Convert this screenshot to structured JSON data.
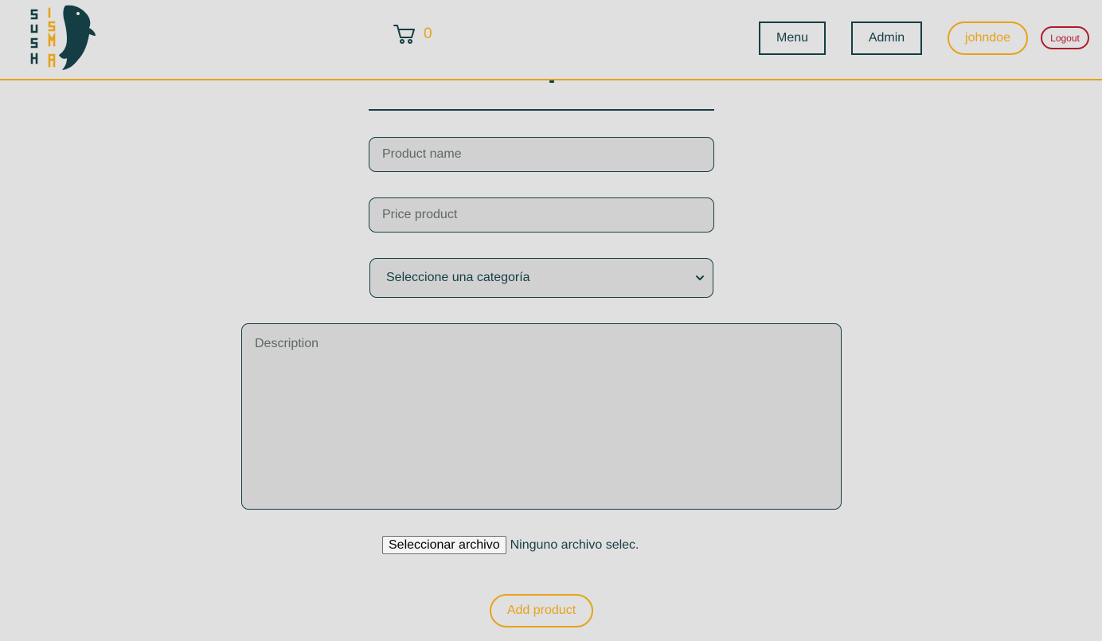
{
  "header": {
    "logo_text": "SUSHISMA",
    "cart_count": "0",
    "nav": {
      "menu_label": "Menu",
      "admin_label": "Admin",
      "user_label": "johndoe",
      "logout_label": "Logout"
    }
  },
  "form": {
    "name_placeholder": "Product name",
    "price_placeholder": "Price product",
    "category_selected": "Seleccione una categoría",
    "description_placeholder": "Description",
    "file_button_label": "Seleccionar archivo",
    "file_status": "Ninguno archivo selec.",
    "submit_label": "Add product"
  },
  "colors": {
    "background": "#e0e0e0",
    "primary": "#143e44",
    "accent": "#e6a21a",
    "danger": "#b01a2a",
    "field_bg": "#d1d1d1"
  },
  "icons": {
    "cart": "cart-icon",
    "logo": "fish-logo-icon",
    "select_arrow": "chevron-down-icon"
  }
}
